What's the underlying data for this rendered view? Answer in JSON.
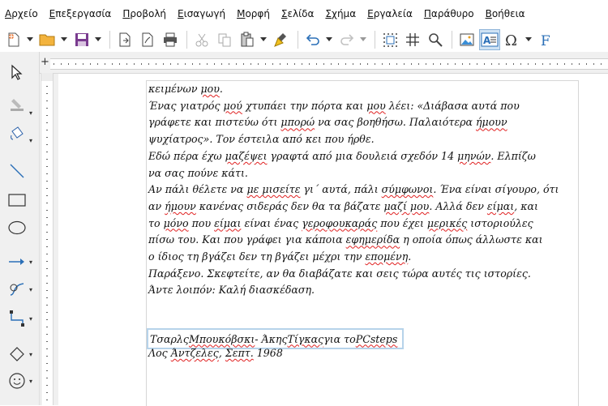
{
  "menu": [
    {
      "label": "Αρχείο",
      "key": "Α",
      "rest": "ρχείο"
    },
    {
      "label": "Επεξεργασία",
      "key": "Ε",
      "rest": "πεξεργασία"
    },
    {
      "label": "Προβολή",
      "key": "Π",
      "rest": "ροβολή"
    },
    {
      "label": "Εισαγωγή",
      "key": "Ε",
      "rest": "ισαγωγή"
    },
    {
      "label": "Μορφή",
      "key": "Μ",
      "rest": "ορφή"
    },
    {
      "label": "Σελίδα",
      "key": "Σ",
      "rest": "ελίδα"
    },
    {
      "label": "Σχήμα",
      "key": "Σ",
      "rest": "χήμα"
    },
    {
      "label": "Εργαλεία",
      "key": "Ε",
      "rest": "ργαλεία"
    },
    {
      "label": "Παράθυρο",
      "key": "Π",
      "rest": "αράθυρο"
    },
    {
      "label": "Βοήθεια",
      "key": "Β",
      "rest": "οήθεια"
    }
  ],
  "toolbar_icons": [
    "new-document-icon",
    "open-folder-icon",
    "save-icon",
    "export-pdf-icon",
    "export-icon",
    "print-icon",
    "cut-icon",
    "copy-icon",
    "paste-icon",
    "clone-formatting-icon",
    "undo-icon",
    "redo-icon",
    "grid-icon",
    "helplines-icon",
    "find-replace-icon",
    "image-icon",
    "textbox-icon",
    "special-character-icon",
    "fontwork-icon"
  ],
  "sidebar_icons": [
    "select-icon",
    "line-color-icon",
    "fill-icon",
    "line-icon",
    "rectangle-icon",
    "ellipse-icon",
    "arrow-line-icon",
    "curve-icon",
    "connector-icon",
    "basic-shapes-icon",
    "smiley-icon"
  ],
  "document": {
    "lines": [
      [
        "κειμένων ",
        {
          "sq": "μου"
        },
        "."
      ],
      [
        "Ένας γιατρός ",
        {
          "sq": "μού"
        },
        " χτυπάει την πόρτα και ",
        {
          "sq": "μου"
        },
        " λέει: «Διάβασα αυτά που"
      ],
      [
        "γράφετε και πιστεύω ότι ",
        {
          "sq": "μπορώ"
        },
        " να σας βοηθήσω. Παλαιότερα ",
        {
          "sq": "ήμουν"
        }
      ],
      [
        "ψυχίατρος». Τον έστειλα από κει που ήρθε."
      ],
      [
        "Εδώ πέρα έχω ",
        {
          "sq": "μαζέψει"
        },
        " γραφτά από μια δουλειά σχεδόν 14 ",
        {
          "sq": "μηνών"
        },
        ". Ελπίζω"
      ],
      [
        "να σας πούνε κάτι."
      ],
      [
        "Αν πάλι θέλετε να ",
        {
          "sq": "με μισείτε"
        },
        " γι΄ αυτά, πάλι ",
        {
          "sq": "σύμφωνοι"
        },
        ". Ένα είναι σίγουρο, ότι"
      ],
      [
        "αν ",
        {
          "sq": "ήμουν"
        },
        " κανένας σιδεράς δεν θα τα βάζατε ",
        {
          "sq": "μαζί μου"
        },
        ". Αλλά δεν ",
        {
          "sq": "είμαι"
        },
        ", και"
      ],
      [
        "το ",
        {
          "sq": "μόνο"
        },
        " που ",
        {
          "sq": "είμαι"
        },
        " είναι ένας ",
        {
          "sq": "γεροφουκαράς"
        },
        " που έχει ",
        {
          "sq": "μερικές"
        },
        " ιστοριούλες"
      ],
      [
        "πίσω του. Και που γράφει για κάποια ",
        {
          "sq": "εφημερίδα"
        },
        " η οποία όπως άλλωστε και"
      ],
      [
        "ο ίδιος τη βγάζει δεν τη βγάζει μέχρι την ",
        {
          "sq": "επομένη"
        },
        "."
      ],
      [
        "Παράξενο. Σκεφτείτε, αν θα διαβάζατε και σεις τώρα αυτές τις ιστορίες."
      ],
      [
        "Άντε λοιπόν: Καλή διασκέδαση."
      ]
    ],
    "signature_1": [
      "Τσαρλς ",
      {
        "sq": "Μπουκόβσκι"
      },
      "- Άκης ",
      {
        "sq": "Τίγκας"
      },
      " για το ",
      {
        "sq": "PCsteps"
      }
    ],
    "signature_2": [
      "Λος ",
      {
        "sq": "Άντζελες"
      },
      ", ",
      {
        "sq": "Σεπτ."
      },
      " 1968"
    ]
  }
}
